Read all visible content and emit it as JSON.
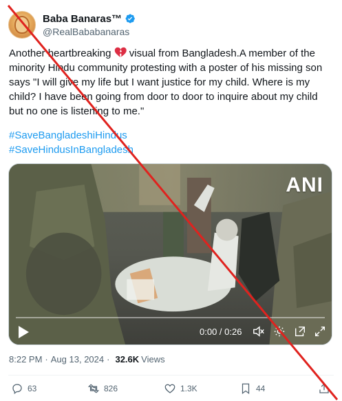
{
  "author": {
    "display_name": "Baba Banaras™",
    "handle": "@RealBababanaras"
  },
  "tweet": {
    "text_before_emoji": "Another heartbreaking ",
    "emoji": "broken-heart-icon",
    "text_after_emoji": " visual from Bangladesh.A member of the minority Hindu community protesting with a poster of his missing son says \"I will give my life but I want justice for my child. Where is my child? I have been going from door to door to inquire about my child but no one is listening to me.\"",
    "hashtags": [
      "#SaveBangladeshiHindus",
      "#SaveHindusInBangladesh"
    ]
  },
  "media": {
    "watermark": "ANI",
    "time_display": "0:00 / 0:26",
    "progress_fraction": 0.0
  },
  "meta": {
    "time": "8:22 PM",
    "date": "Aug 13, 2024",
    "views_count": "32.6K",
    "views_label": "Views"
  },
  "actions": {
    "replies": "63",
    "reposts": "826",
    "likes": "1.3K",
    "bookmarks": "44"
  },
  "colors": {
    "link": "#1d9bf0",
    "verified": "#1d9bf0",
    "strike_line": "#e0221e",
    "secondary_text": "#536471"
  }
}
